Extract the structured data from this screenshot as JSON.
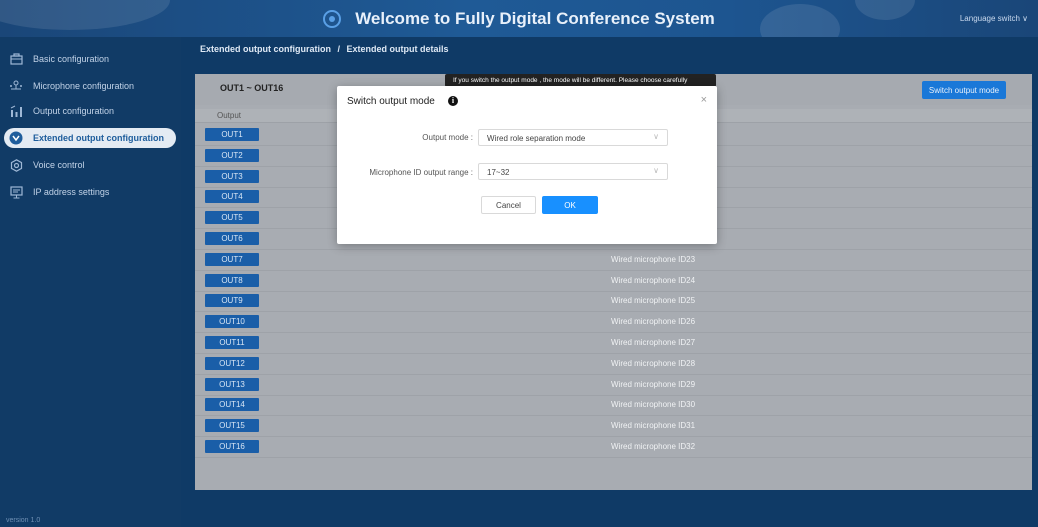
{
  "header": {
    "title": "Welcome to Fully Digital Conference System",
    "language_switch": "Language switch",
    "language_chevron": "∨"
  },
  "sidebar": {
    "items": [
      {
        "label": "Basic configuration",
        "icon": "briefcase-icon"
      },
      {
        "label": "Microphone configuration",
        "icon": "microphone-network-icon"
      },
      {
        "label": "Output configuration",
        "icon": "output-bars-icon"
      },
      {
        "label": "Extended output configuration",
        "icon": "extended-output-icon",
        "active": true
      },
      {
        "label": "Voice control",
        "icon": "voice-gear-icon"
      },
      {
        "label": "IP address settings",
        "icon": "monitor-icon"
      }
    ],
    "version": "version  1.0"
  },
  "breadcrumb": {
    "parent": "Extended output configuration",
    "separator": "/",
    "current": "Extended output details"
  },
  "panel": {
    "range_label": "OUT1 ~ OUT16",
    "switch_button": "Switch output mode",
    "column_output": "Output",
    "rows": [
      {
        "out": "OUT1",
        "mic": ""
      },
      {
        "out": "OUT2",
        "mic": ""
      },
      {
        "out": "OUT3",
        "mic": ""
      },
      {
        "out": "OUT4",
        "mic": ""
      },
      {
        "out": "OUT5",
        "mic": ""
      },
      {
        "out": "OUT6",
        "mic": ""
      },
      {
        "out": "OUT7",
        "mic": "Wired microphone ID23"
      },
      {
        "out": "OUT8",
        "mic": "Wired microphone ID24"
      },
      {
        "out": "OUT9",
        "mic": "Wired microphone ID25"
      },
      {
        "out": "OUT10",
        "mic": "Wired microphone ID26"
      },
      {
        "out": "OUT11",
        "mic": "Wired microphone ID27"
      },
      {
        "out": "OUT12",
        "mic": "Wired microphone ID28"
      },
      {
        "out": "OUT13",
        "mic": "Wired microphone ID29"
      },
      {
        "out": "OUT14",
        "mic": "Wired microphone ID30"
      },
      {
        "out": "OUT15",
        "mic": "Wired microphone ID31"
      },
      {
        "out": "OUT16",
        "mic": "Wired microphone ID32"
      }
    ]
  },
  "modal": {
    "title": "Switch output mode",
    "info_glyph": "i",
    "close_glyph": "×",
    "tooltip": "If you switch the output mode , the mode will be different. Please choose carefully",
    "output_mode_label": "Output mode :",
    "output_mode_value": "Wired role separation mode",
    "mic_range_label": "Microphone ID output range :",
    "mic_range_value": "17~32",
    "chevron": "∨",
    "cancel": "Cancel",
    "ok": "OK"
  },
  "colors": {
    "accent": "#1890ff",
    "out_tag": "#1a5ea8",
    "sidebar_bg": "#113b66"
  }
}
